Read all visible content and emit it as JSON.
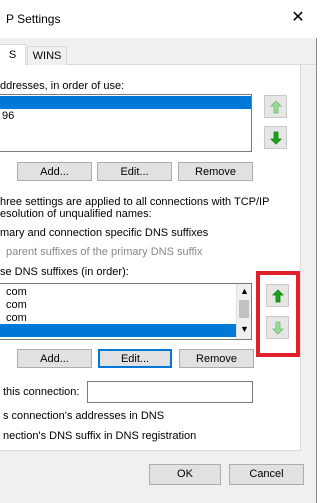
{
  "window": {
    "title": "P Settings"
  },
  "tabs": [
    {
      "label": "S"
    },
    {
      "label": "WINS"
    }
  ],
  "dns_servers": {
    "heading": "ddresses, in order of use:",
    "items": [
      {
        "text": ""
      },
      {
        "text": "96"
      }
    ],
    "selected_index": 0,
    "buttons": {
      "add": "Add...",
      "edit": "Edit...",
      "remove": "Remove"
    }
  },
  "info_lines": [
    "hree settings are applied to all connections with TCP/IP",
    "esolution of unqualified names:"
  ],
  "radio_primary": "mary and connection specific DNS suffixes",
  "radio_parent": "parent suffixes of the primary DNS suffix",
  "suffix_heading": "se DNS suffixes (in order):",
  "suffixes": {
    "items": [
      {
        "text": "com"
      },
      {
        "text": "com"
      },
      {
        "text": "com"
      },
      {
        "text": ""
      }
    ],
    "selected_index": 3,
    "buttons": {
      "add": "Add...",
      "edit": "Edit...",
      "remove": "Remove"
    }
  },
  "connection_label": "this connection:",
  "connection_value": "",
  "check_register": "s connection's addresses in DNS",
  "check_suffix": "nection's DNS suffix in DNS registration",
  "footer": {
    "ok": "OK",
    "cancel": "Cancel"
  },
  "icons": {
    "up": "arrow-up-icon",
    "down": "arrow-down-icon",
    "close": "close-icon"
  },
  "colors": {
    "selection": "#0078d7",
    "arrow_green": "#16a516",
    "arrow_green_disabled": "#8fd48f",
    "highlight_box": "#e0202a"
  }
}
